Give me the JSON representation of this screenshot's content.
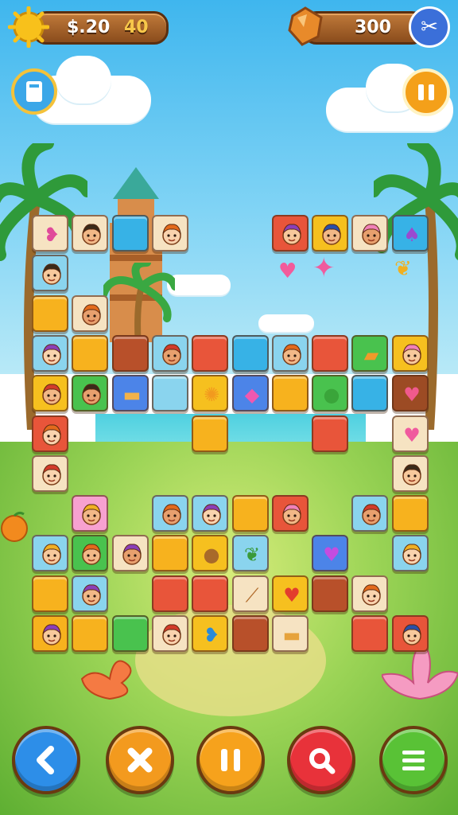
{
  "hud": {
    "money_label": "$.20",
    "coins_value": "40",
    "score_value": "300",
    "icons": {
      "left": "sun-icon",
      "right_gem": "amber-gem-icon",
      "right_tool": "tools-icon",
      "left_button": "map-book-icon",
      "right_button": "pause-bars-icon"
    }
  },
  "controls": [
    {
      "name": "back-button",
      "icon": "chevron-left-icon",
      "color": "#2d8ee8"
    },
    {
      "name": "shuffle-button",
      "icon": "cross-icon",
      "color": "#f39a1e"
    },
    {
      "name": "pause-button",
      "icon": "pause-icon",
      "color": "#f6a21c"
    },
    {
      "name": "hint-button",
      "icon": "magnifier-icon",
      "color": "#e8323a"
    },
    {
      "name": "menu-button",
      "icon": "menu-icon",
      "color": "#59c236"
    }
  ],
  "board": {
    "tile_kinds": {
      "orange": "#f7b21e",
      "yellow": "#f6c01f",
      "red": "#e8553a",
      "brick": "#b8502a",
      "cyan": "#37b2e6",
      "lightblue": "#8ad4ee",
      "green": "#49c24e",
      "pink": "#f7a1d0",
      "cream": "#f6e3c2",
      "blue": "#4c84e8",
      "darkbrown": "#9c4b24"
    },
    "tiles": [
      {
        "kind": "cream",
        "icon": "pink-bird-icon",
        "col": 0,
        "row": 0
      },
      {
        "kind": "cream",
        "icon": "orange-face-icon",
        "col": 1,
        "row": 0
      },
      {
        "kind": "cyan",
        "icon": "",
        "col": 2,
        "row": 0
      },
      {
        "kind": "cream",
        "icon": "orange-cat-icon",
        "col": 3,
        "row": 0
      },
      {
        "kind": "red",
        "icon": "pink-girl-icon",
        "col": 6,
        "row": 0
      },
      {
        "kind": "yellow",
        "icon": "girl-face-icon",
        "col": 7,
        "row": 0
      },
      {
        "kind": "cream",
        "icon": "smile-face-icon",
        "col": 8,
        "row": 0
      },
      {
        "kind": "cyan",
        "icon": "purple-mushroom-icon",
        "col": 9,
        "row": 0
      },
      {
        "kind": "lightblue",
        "icon": "kid-face-icon",
        "col": 0,
        "row": 1
      },
      {
        "kind": "orange",
        "icon": "",
        "col": 0,
        "row": 2
      },
      {
        "kind": "cream",
        "icon": "sun-face-icon",
        "col": 1,
        "row": 2
      },
      {
        "kind": "lightblue",
        "icon": "purple-hair-kid-icon",
        "col": 0,
        "row": 3
      },
      {
        "kind": "orange",
        "icon": "",
        "col": 1,
        "row": 3
      },
      {
        "kind": "brick",
        "icon": "",
        "col": 2,
        "row": 3
      },
      {
        "kind": "lightblue",
        "icon": "blonde-kid-icon",
        "col": 3,
        "row": 3
      },
      {
        "kind": "red",
        "icon": "",
        "col": 4,
        "row": 3
      },
      {
        "kind": "cyan",
        "icon": "",
        "col": 5,
        "row": 3
      },
      {
        "kind": "lightblue",
        "icon": "pink-cap-kid-icon",
        "col": 6,
        "row": 3
      },
      {
        "kind": "red",
        "icon": "",
        "col": 7,
        "row": 3
      },
      {
        "kind": "green",
        "icon": "ticket-icon",
        "col": 8,
        "row": 3
      },
      {
        "kind": "yellow",
        "icon": "blue-cap-kid-icon",
        "col": 9,
        "row": 3
      },
      {
        "kind": "yellow",
        "icon": "red-hat-kid-icon",
        "col": 0,
        "row": 4
      },
      {
        "kind": "green",
        "icon": "cat-face-icon",
        "col": 1,
        "row": 4
      },
      {
        "kind": "blue",
        "icon": "bread-icon",
        "col": 2,
        "row": 4
      },
      {
        "kind": "lightblue",
        "icon": "",
        "col": 3,
        "row": 4
      },
      {
        "kind": "yellow",
        "icon": "candy-icon",
        "col": 4,
        "row": 4
      },
      {
        "kind": "blue",
        "icon": "pink-gem-icon",
        "col": 5,
        "row": 4
      },
      {
        "kind": "orange",
        "icon": "",
        "col": 6,
        "row": 4
      },
      {
        "kind": "green",
        "icon": "green-apple-icon",
        "col": 7,
        "row": 4
      },
      {
        "kind": "cyan",
        "icon": "",
        "col": 8,
        "row": 4
      },
      {
        "kind": "darkbrown",
        "icon": "heart-icon",
        "col": 9,
        "row": 4
      },
      {
        "kind": "red",
        "icon": "orange-hair-kid-icon",
        "col": 0,
        "row": 5
      },
      {
        "kind": "orange",
        "icon": "",
        "col": 4,
        "row": 5
      },
      {
        "kind": "red",
        "icon": "",
        "col": 7,
        "row": 5
      },
      {
        "kind": "cream",
        "icon": "pink-heart-icon",
        "col": 9,
        "row": 5
      },
      {
        "kind": "cream",
        "icon": "green-monster-icon",
        "col": 0,
        "row": 6
      },
      {
        "kind": "cream",
        "icon": "orange-kid-icon",
        "col": 9,
        "row": 6
      },
      {
        "kind": "pink",
        "icon": "pink-bunny-icon",
        "col": 1,
        "row": 7
      },
      {
        "kind": "lightblue",
        "icon": "pink-hat-kid-icon",
        "col": 3,
        "row": 7
      },
      {
        "kind": "lightblue",
        "icon": "dark-hair-kid-icon",
        "col": 4,
        "row": 7
      },
      {
        "kind": "orange",
        "icon": "",
        "col": 5,
        "row": 7
      },
      {
        "kind": "red",
        "icon": "red-cap-kid-icon",
        "col": 6,
        "row": 7
      },
      {
        "kind": "lightblue",
        "icon": "ginger-kid-icon",
        "col": 8,
        "row": 7
      },
      {
        "kind": "orange",
        "icon": "",
        "col": 9,
        "row": 7
      },
      {
        "kind": "lightblue",
        "icon": "blonde-girl-icon",
        "col": 0,
        "row": 8
      },
      {
        "kind": "green",
        "icon": "plant-monster-icon",
        "col": 1,
        "row": 8
      },
      {
        "kind": "cream",
        "icon": "orange-boy-icon",
        "col": 2,
        "row": 8
      },
      {
        "kind": "orange",
        "icon": "",
        "col": 3,
        "row": 8
      },
      {
        "kind": "yellow",
        "icon": "acorn-icon",
        "col": 4,
        "row": 8
      },
      {
        "kind": "lightblue",
        "icon": "leaf-icon",
        "col": 5,
        "row": 8
      },
      {
        "kind": "blue",
        "icon": "purple-heart-icon",
        "col": 7,
        "row": 8
      },
      {
        "kind": "lightblue",
        "icon": "pink-hat-boy-icon",
        "col": 9,
        "row": 8
      },
      {
        "kind": "orange",
        "icon": "",
        "col": 0,
        "row": 9
      },
      {
        "kind": "lightblue",
        "icon": "blonde-kid-icon",
        "col": 1,
        "row": 9
      },
      {
        "kind": "red",
        "icon": "",
        "col": 3,
        "row": 9
      },
      {
        "kind": "red",
        "icon": "",
        "col": 4,
        "row": 9
      },
      {
        "kind": "cream",
        "icon": "broom-icon",
        "col": 5,
        "row": 9
      },
      {
        "kind": "yellow",
        "icon": "red-heart-icon",
        "col": 6,
        "row": 9
      },
      {
        "kind": "brick",
        "icon": "",
        "col": 7,
        "row": 9
      },
      {
        "kind": "cream",
        "icon": "orange-smile-icon",
        "col": 8,
        "row": 9
      },
      {
        "kind": "orange",
        "icon": "red-cap-boy-icon",
        "col": 0,
        "row": 10
      },
      {
        "kind": "orange",
        "icon": "",
        "col": 1,
        "row": 10
      },
      {
        "kind": "green",
        "icon": "",
        "col": 2,
        "row": 10
      },
      {
        "kind": "cream",
        "icon": "red-hair-kid-icon",
        "col": 3,
        "row": 10
      },
      {
        "kind": "yellow",
        "icon": "blue-bird-icon",
        "col": 4,
        "row": 10
      },
      {
        "kind": "brick",
        "icon": "",
        "col": 5,
        "row": 10
      },
      {
        "kind": "cream",
        "icon": "baguette-icon",
        "col": 6,
        "row": 10
      },
      {
        "kind": "red",
        "icon": "",
        "col": 8,
        "row": 10
      },
      {
        "kind": "red",
        "icon": "pink-hat-girl-icon",
        "col": 9,
        "row": 10
      }
    ]
  }
}
